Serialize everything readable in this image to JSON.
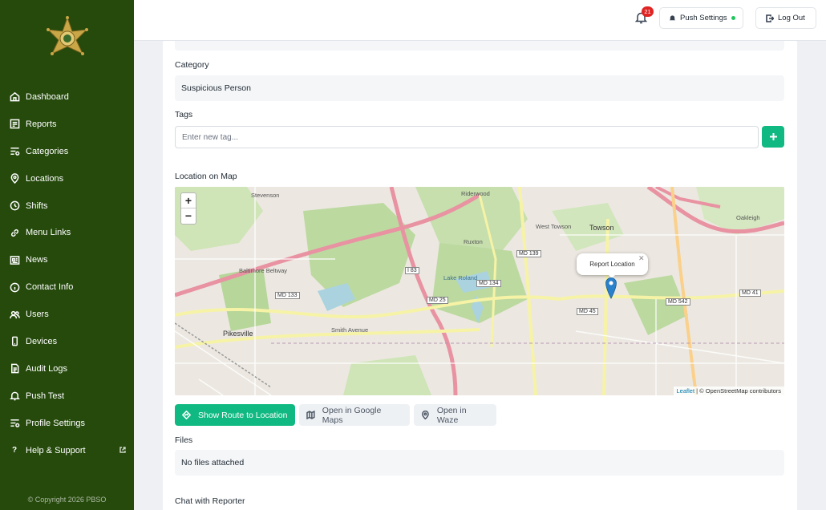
{
  "sidebar": {
    "items": [
      {
        "label": "Dashboard",
        "icon": "home-icon"
      },
      {
        "label": "Reports",
        "icon": "reports-icon"
      },
      {
        "label": "Categories",
        "icon": "categories-icon"
      },
      {
        "label": "Locations",
        "icon": "location-pin-icon"
      },
      {
        "label": "Shifts",
        "icon": "clock-icon"
      },
      {
        "label": "Menu Links",
        "icon": "link-icon"
      },
      {
        "label": "News",
        "icon": "newspaper-icon"
      },
      {
        "label": "Contact Info",
        "icon": "info-icon"
      },
      {
        "label": "Users",
        "icon": "users-icon"
      },
      {
        "label": "Devices",
        "icon": "phone-icon"
      },
      {
        "label": "Audit Logs",
        "icon": "document-icon"
      },
      {
        "label": "Push Test",
        "icon": "bell-icon"
      },
      {
        "label": "Profile Settings",
        "icon": "settings-icon"
      },
      {
        "label": "Help & Support",
        "icon": "question-icon"
      }
    ],
    "copyright": "© Copyright 2026 PBSO"
  },
  "topbar": {
    "notification_count": "21",
    "push_settings_label": "Push Settings",
    "logout_label": "Log Out"
  },
  "report": {
    "category_label": "Category",
    "category_value": "Suspicious Person",
    "tags_label": "Tags",
    "tags_placeholder": "Enter new tag...",
    "location_label": "Location on Map",
    "files_label": "Files",
    "files_value": "No files attached",
    "chat_label": "Chat with Reporter"
  },
  "map": {
    "popup_text": "Report Location",
    "zoom_in": "+",
    "zoom_out": "−",
    "attribution_link": "Leaflet",
    "attribution_text": " | © OpenStreetMap contributors",
    "labels": {
      "stevenson": "Stevenson",
      "riderwood": "Riderwood",
      "towson": "Towson",
      "pikesville": "Pikesville",
      "ruxton": "Ruxton",
      "oakleigh": "Oakleigh",
      "lake_roland": "Lake Roland",
      "west_towson": "West Towson",
      "smith_avenue": "Smith Avenue",
      "baltimore_beltway": "Baltimore Beltway",
      "md133": "MD 133",
      "md25": "MD 25",
      "md134": "MD 134",
      "md139": "MD 139",
      "md45": "MD 45",
      "md542": "MD 542",
      "md41": "MD 41",
      "i83": "I 83"
    }
  },
  "map_actions": {
    "route_label": "Show Route to Location",
    "google_label": "Open in Google Maps",
    "waze_label": "Open in Waze"
  },
  "colors": {
    "sidebar_bg": "#254a0c",
    "accent": "#10b981",
    "badge": "#e02424"
  }
}
